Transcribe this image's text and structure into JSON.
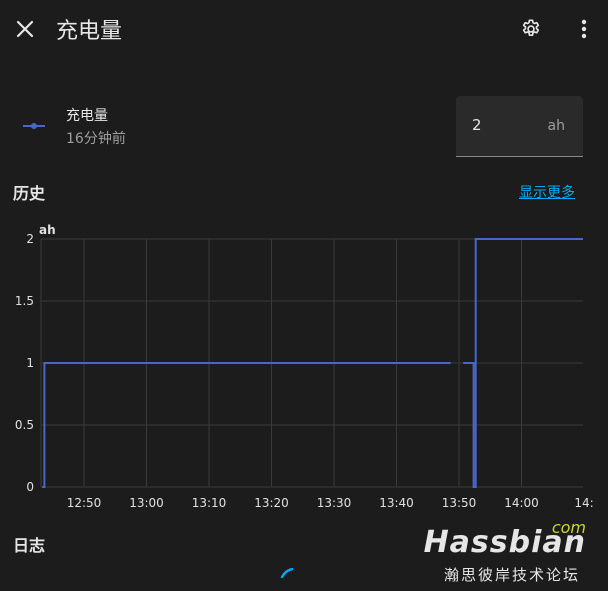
{
  "header": {
    "title": "充电量"
  },
  "entity": {
    "name": "充电量",
    "last_changed": "16分钟前",
    "value": "2",
    "unit": "ah"
  },
  "history": {
    "title": "历史",
    "show_more": "显示更多"
  },
  "logbook": {
    "title": "日志"
  },
  "watermark": {
    "brand": "Hassbian",
    "suffix": "com",
    "subtitle": "瀚思彼岸技术论坛"
  },
  "colors": {
    "background": "#1c1c1c",
    "line": "#4a66c8",
    "accent": "#03a9f4",
    "grid": "#3a3a3a"
  },
  "icons": {
    "close": "close-icon",
    "settings": "gear-icon",
    "more": "more-vert-icon"
  },
  "chart_data": {
    "type": "line",
    "ylabel": "ah",
    "ylim": [
      0,
      2
    ],
    "yticks": [
      "0",
      "0.5",
      "1",
      "1.5",
      "2"
    ],
    "xticks": [
      "12:50",
      "13:00",
      "13:10",
      "13:20",
      "13:30",
      "13:40",
      "13:50",
      "14:00",
      "14:"
    ],
    "grid": true,
    "series": [
      {
        "step": true,
        "segments": [
          [
            [
              "12:43:20",
              0
            ],
            [
              "12:43:40",
              0
            ],
            [
              "12:43:40",
              1
            ],
            [
              "13:48:40",
              1
            ]
          ],
          [
            [
              "13:50:40",
              1
            ],
            [
              "13:52:20",
              1
            ],
            [
              "13:52:20",
              0
            ],
            [
              "13:52:40",
              0
            ],
            [
              "13:52:40",
              2
            ],
            [
              "14:10:00",
              2
            ]
          ]
        ]
      }
    ]
  }
}
